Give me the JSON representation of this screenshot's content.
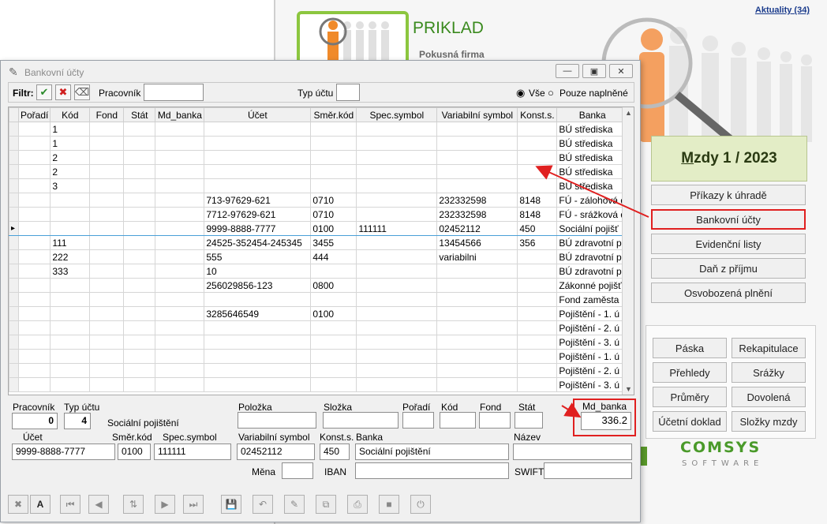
{
  "app": {
    "news_link": "Aktuality (34)",
    "company_name": "PRIKLAD",
    "company_sub": "Pokusná firma",
    "month_label_prefix": "M",
    "month_label_rest": "zdy  1 / 2023",
    "side_menu": [
      "Příkazy k úhradě",
      "Bankovní účty",
      "Evidenční listy",
      "Daň z příjmu",
      "Osvobozená plnění"
    ],
    "group_buttons": [
      "Páska",
      "Rekapitulace",
      "Přehledy",
      "Srážky",
      "Průměry",
      "Dovolená",
      "Účetní doklad",
      "Složky mzdy"
    ]
  },
  "dialog": {
    "title": "Bankovní účty",
    "filter_label": "Filtr:",
    "pracovnik_label": "Pracovník",
    "typ_uctu_label": "Typ účtu",
    "radio_all": "Vše",
    "radio_filled": "Pouze naplněné",
    "columns": [
      "Pořadí",
      "Kód",
      "Fond",
      "Stát",
      "Md_banka",
      "Účet",
      "Směr.kód",
      "Spec.symbol",
      "Variabilní symbol",
      "Konst.s.",
      "Banka"
    ],
    "rows": [
      [
        "",
        "1",
        "",
        "",
        "",
        "",
        "",
        "",
        "",
        "",
        "BÚ střediska"
      ],
      [
        "",
        "1",
        "",
        "",
        "",
        "",
        "",
        "",
        "",
        "",
        "BÚ střediska"
      ],
      [
        "",
        "2",
        "",
        "",
        "",
        "",
        "",
        "",
        "",
        "",
        "BÚ střediska"
      ],
      [
        "",
        "2",
        "",
        "",
        "",
        "",
        "",
        "",
        "",
        "",
        "BÚ střediska"
      ],
      [
        "",
        "3",
        "",
        "",
        "",
        "",
        "",
        "",
        "",
        "",
        "BÚ střediska"
      ],
      [
        "",
        "",
        "",
        "",
        "",
        "713-97629-621",
        "0710",
        "",
        "232332598",
        "8148",
        "FÚ - zálohová d"
      ],
      [
        "",
        "",
        "",
        "",
        "",
        "7712-97629-621",
        "0710",
        "",
        "232332598",
        "8148",
        "FÚ - srážková d"
      ],
      [
        "",
        "",
        "",
        "",
        "",
        "9999-8888-7777",
        "0100",
        "111111",
        "02452112",
        "450",
        "Sociální pojišť"
      ],
      [
        "",
        "111",
        "",
        "",
        "",
        "24525-352454-245345",
        "3455",
        "",
        "13454566",
        "356",
        "BÚ zdravotní p"
      ],
      [
        "",
        "222",
        "",
        "",
        "",
        "555",
        "444",
        "",
        "variabilni",
        "",
        "BÚ zdravotní p"
      ],
      [
        "",
        "333",
        "",
        "",
        "",
        "10",
        "",
        "",
        "",
        "",
        "BÚ zdravotní p"
      ],
      [
        "",
        "",
        "",
        "",
        "",
        "256029856-123",
        "0800",
        "",
        "",
        "",
        "Zákonné pojišť"
      ],
      [
        "",
        "",
        "",
        "",
        "",
        "",
        "",
        "",
        "",
        "",
        "Fond zaměsta"
      ],
      [
        "",
        "",
        "",
        "",
        "",
        "3285646549",
        "0100",
        "",
        "",
        "",
        "Pojištění - 1. ú"
      ],
      [
        "",
        "",
        "",
        "",
        "",
        "",
        "",
        "",
        "",
        "",
        "Pojištění - 2. ú"
      ],
      [
        "",
        "",
        "",
        "",
        "",
        "",
        "",
        "",
        "",
        "",
        "Pojištění - 3. ú"
      ],
      [
        "",
        "",
        "",
        "",
        "",
        "",
        "",
        "",
        "",
        "",
        "Pojištění - 1. ú"
      ],
      [
        "",
        "",
        "",
        "",
        "",
        "",
        "",
        "",
        "",
        "",
        "Pojištění - 2. ú"
      ],
      [
        "",
        "",
        "",
        "",
        "",
        "",
        "",
        "",
        "",
        "",
        "Pojištění - 3. ú"
      ]
    ],
    "selected_row": 7,
    "detail": {
      "pracovnik_label": "Pracovník",
      "pracovnik_value": "0",
      "typ_uctu_label": "Typ účtu",
      "typ_uctu_value": "4",
      "typ_uctu_name": "Sociální pojištění",
      "polozka_label": "Položka",
      "slozka_label": "Složka",
      "poradi_label": "Pořadí",
      "kod_label": "Kód",
      "fond_label": "Fond",
      "stat_label": "Stát",
      "md_banka_label": "Md_banka",
      "md_banka_value": "336.2",
      "ucet_label": "Účet",
      "ucet_value": "9999-8888-7777",
      "smer_kod_label": "Směr.kód",
      "smer_kod_value": "0100",
      "spec_symbol_label": "Spec.symbol",
      "spec_symbol_value": "111111",
      "var_symbol_label": "Variabilní symbol",
      "var_symbol_value": "02452112",
      "konst_label": "Konst.s.",
      "konst_value": "450",
      "banka_label": "Banka",
      "banka_value": "Sociální pojištění",
      "nazev_label": "Název",
      "mena_label": "Měna",
      "iban_label": "IBAN",
      "swift_label": "SWIFT"
    }
  }
}
